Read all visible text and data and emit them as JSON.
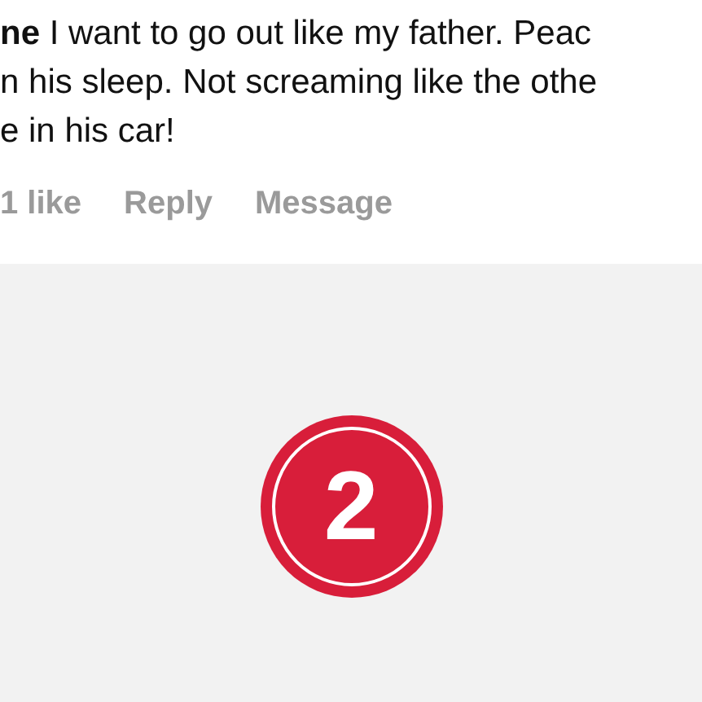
{
  "comment": {
    "lines": [
      "**ne** I want to go out like my father. Peac",
      "n his sleep. Not screaming like the othe",
      "e in his car!"
    ],
    "likes": "1 like",
    "reply": "Reply",
    "message": "Message"
  },
  "badge": {
    "number": "2"
  }
}
